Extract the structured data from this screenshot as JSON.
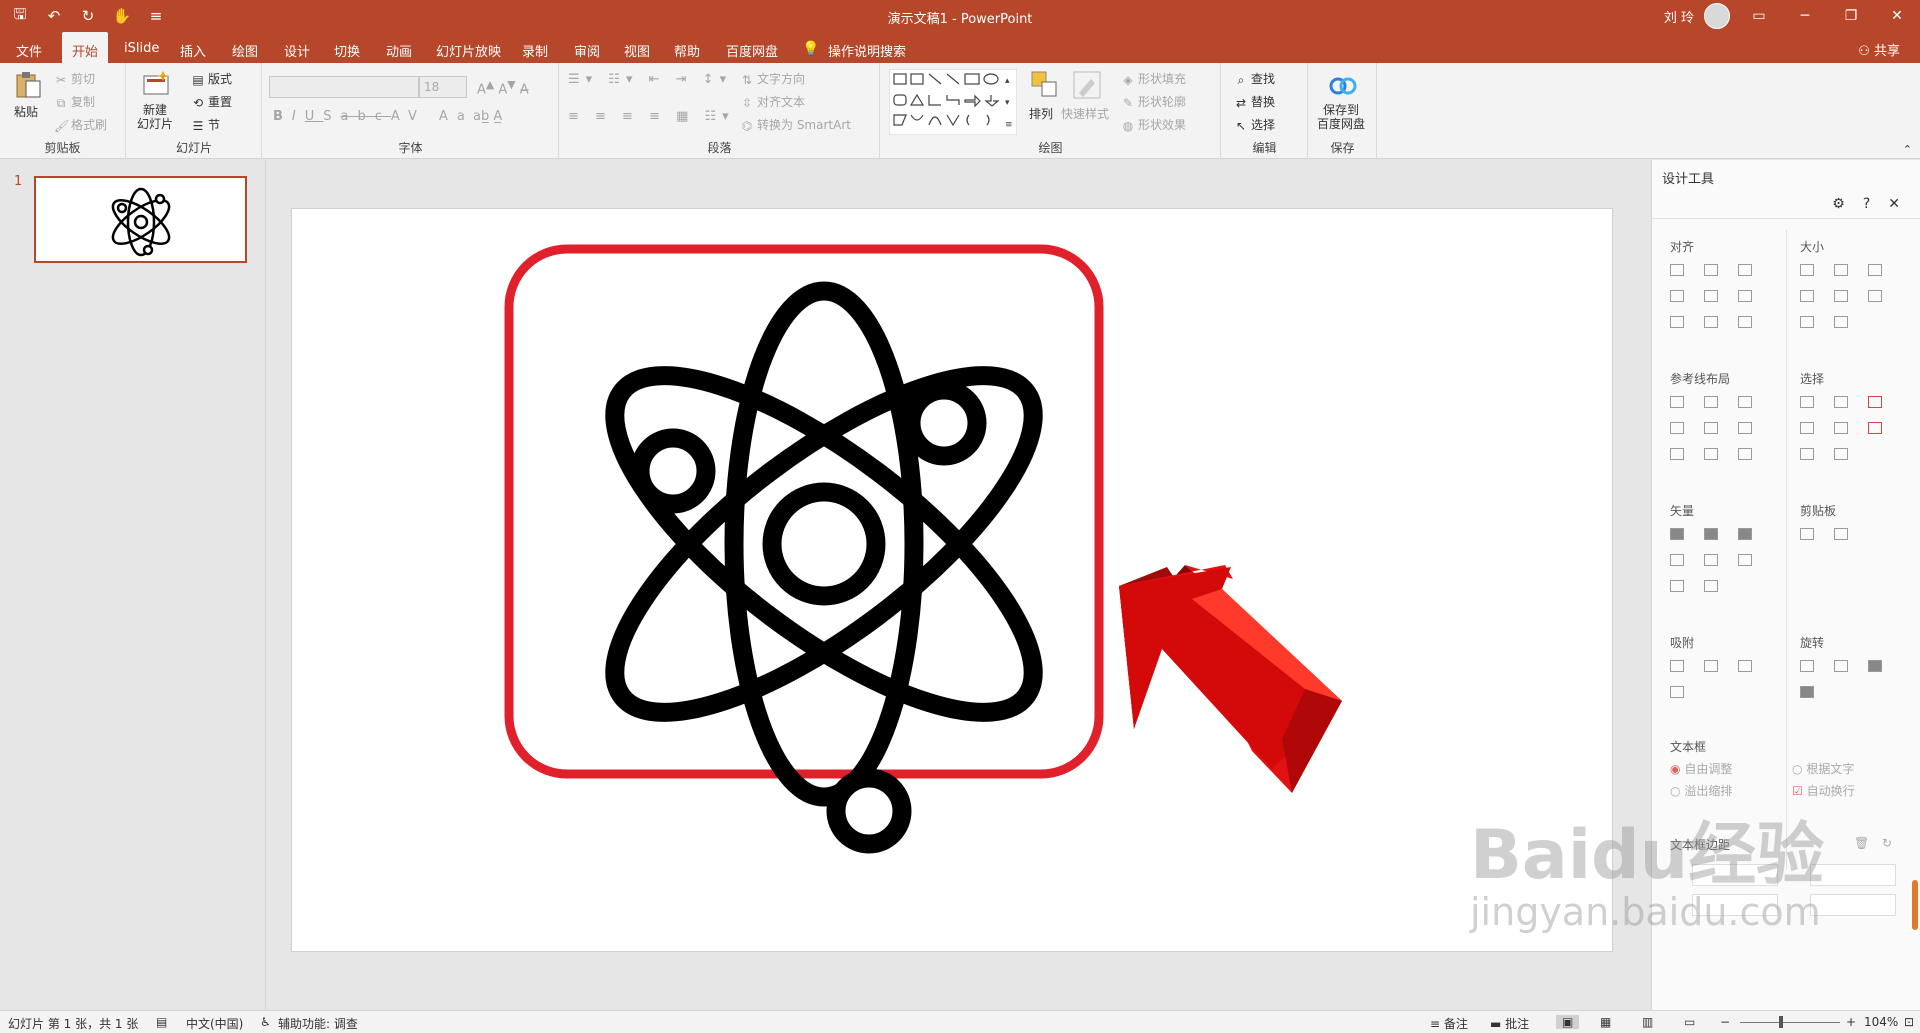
{
  "titlebar": {
    "doc_title": "演示文稿1  -  PowerPoint",
    "user_name": "刘 玲",
    "qat": {
      "save": "🖫",
      "undo": "↶",
      "redo": "↻",
      "touch": "✋",
      "customize": "≡"
    },
    "win": {
      "ribbon_opts": "▭",
      "minimize": "─",
      "restore": "❐",
      "close": "✕"
    }
  },
  "tabs": [
    {
      "label": "文件"
    },
    {
      "label": "开始"
    },
    {
      "label": "iSlide"
    },
    {
      "label": "插入"
    },
    {
      "label": "绘图"
    },
    {
      "label": "设计"
    },
    {
      "label": "切换"
    },
    {
      "label": "动画"
    },
    {
      "label": "幻灯片放映"
    },
    {
      "label": "录制"
    },
    {
      "label": "审阅"
    },
    {
      "label": "视图"
    },
    {
      "label": "帮助"
    },
    {
      "label": "百度网盘"
    },
    {
      "label": "操作说明搜索"
    }
  ],
  "share_label": "共享",
  "ribbon": {
    "clipboard": {
      "paste": "粘贴",
      "cut": "剪切",
      "copy": "复制",
      "format_painter": "格式刷",
      "label": "剪贴板"
    },
    "slides": {
      "new_slide": "新建\n幻灯片",
      "layout": "版式",
      "reset": "重置",
      "section": "节",
      "label": "幻灯片"
    },
    "font": {
      "size": "18",
      "label": "字体"
    },
    "paragraph": {
      "text_direction": "文字方向",
      "align_text": "对齐文本",
      "smartart": "转换为 SmartArt",
      "label": "段落"
    },
    "drawing": {
      "arrange": "排列",
      "quick_styles": "快速样式",
      "fill": "形状填充",
      "outline": "形状轮廓",
      "effects": "形状效果",
      "label": "绘图"
    },
    "editing": {
      "find": "查找",
      "replace": "替换",
      "select": "选择",
      "label": "编辑"
    },
    "save": {
      "save_baidu": "保存到\n百度网盘",
      "label": "保存"
    }
  },
  "thumbs": {
    "slide_number": "1"
  },
  "design_panel": {
    "title": "设计工具",
    "sections": {
      "align": "对齐",
      "size": "大小",
      "guides": "参考线布局",
      "select": "选择",
      "vector": "矢量",
      "clipboard": "剪贴板",
      "snap": "吸附",
      "rotate": "旋转",
      "textbox": "文本框",
      "textbox_margin": "文本框边距"
    },
    "textbox_opts": {
      "auto_adjust": "自由调整",
      "fit_text": "根据文字",
      "overflow": "溢出缩排",
      "auto_wrap": "自动换行"
    }
  },
  "status": {
    "slide_info": "幻灯片 第 1 张，共 1 张",
    "language": "中文(中国)",
    "accessibility": "辅助功能: 调查",
    "notes": "备注",
    "comments": "批注",
    "zoom": "104%"
  },
  "watermark": {
    "line1": "Baidu经验",
    "line2": "jingyan.baidu.com"
  },
  "colors": {
    "accent": "#b7472a",
    "frame": "#e0202a",
    "arrow": "#d40a0a"
  }
}
